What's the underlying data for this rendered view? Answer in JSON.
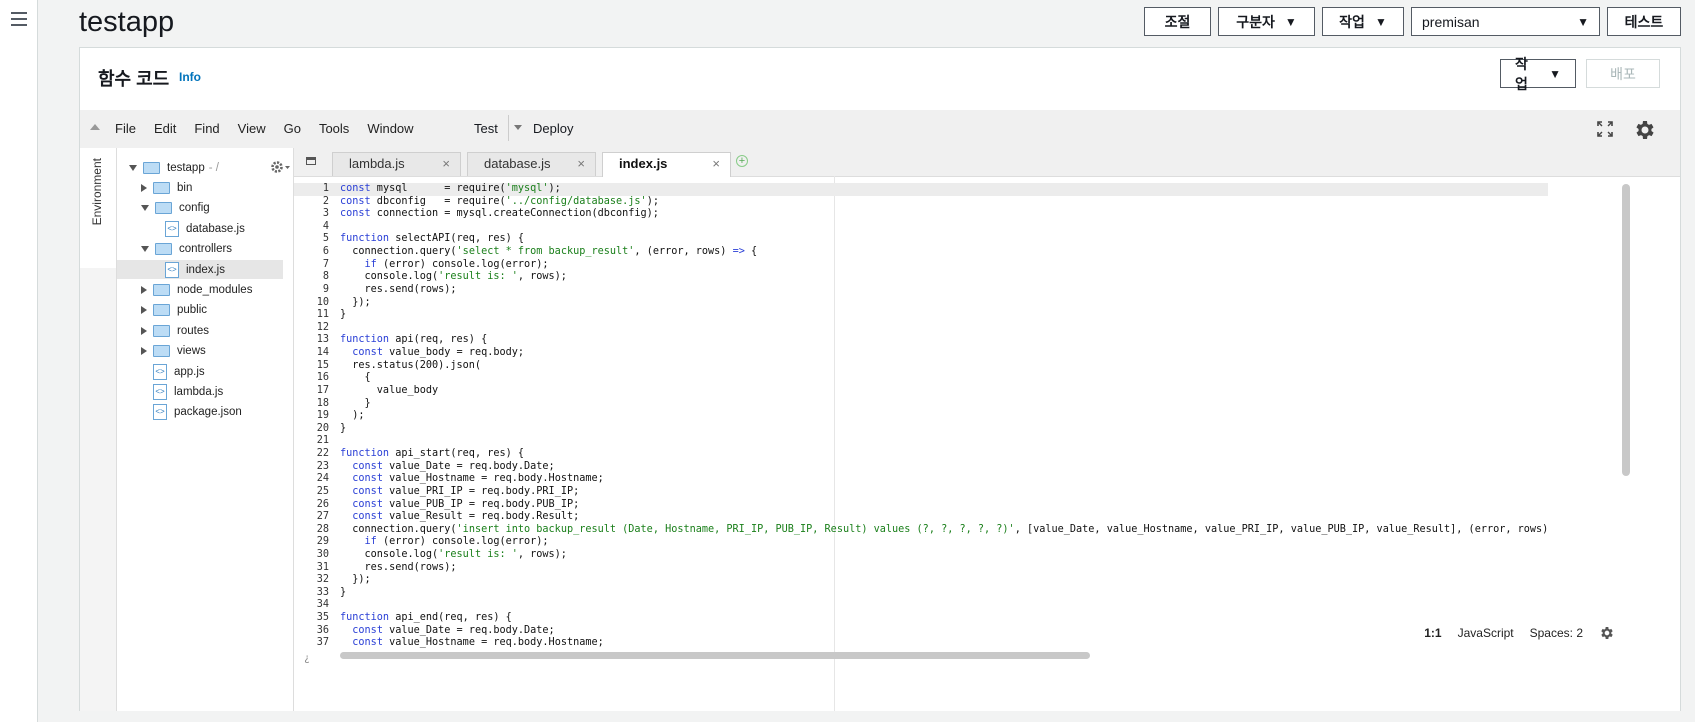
{
  "app": {
    "title": "testapp"
  },
  "top_actions": {
    "adjust": "조절",
    "qualifier": "구분자",
    "actions": "작업",
    "alias_selected": "premisan",
    "test": "테스트"
  },
  "panel": {
    "title": "함수 코드",
    "info": "Info",
    "actions": "작업",
    "deploy": "배포"
  },
  "menubar": {
    "items": [
      "File",
      "Edit",
      "Find",
      "View",
      "Go",
      "Tools",
      "Window"
    ],
    "test": "Test",
    "deploy": "Deploy"
  },
  "side_tab": {
    "environment": "Environment"
  },
  "tree": {
    "root": "testapp",
    "root_suffix": "- /",
    "items": [
      {
        "name": "bin",
        "type": "folder",
        "expanded": false
      },
      {
        "name": "config",
        "type": "folder",
        "expanded": true
      },
      {
        "name": "database.js",
        "type": "file"
      },
      {
        "name": "controllers",
        "type": "folder",
        "expanded": true
      },
      {
        "name": "index.js",
        "type": "file",
        "selected": true
      },
      {
        "name": "node_modules",
        "type": "folder",
        "expanded": false
      },
      {
        "name": "public",
        "type": "folder",
        "expanded": false
      },
      {
        "name": "routes",
        "type": "folder",
        "expanded": false
      },
      {
        "name": "views",
        "type": "folder",
        "expanded": false
      },
      {
        "name": "app.js",
        "type": "file"
      },
      {
        "name": "lambda.js",
        "type": "file"
      },
      {
        "name": "package.json",
        "type": "file"
      }
    ]
  },
  "tabs": [
    {
      "label": "lambda.js",
      "active": false
    },
    {
      "label": "database.js",
      "active": false
    },
    {
      "label": "index.js",
      "active": true
    }
  ],
  "code": [
    "const mysql      = require('mysql');",
    "const dbconfig   = require('../config/database.js');",
    "const connection = mysql.createConnection(dbconfig);",
    "",
    "function selectAPI(req, res) {",
    "  connection.query('select * from backup_result', (error, rows) => {",
    "    if (error) console.log(error);",
    "    console.log('result is: ', rows);",
    "    res.send(rows);",
    "  });",
    "}",
    "",
    "function api(req, res) {",
    "  const value_body = req.body;",
    "  res.status(200).json(",
    "    {",
    "      value_body",
    "    }",
    "  );",
    "}",
    "",
    "function api_start(req, res) {",
    "  const value_Date = req.body.Date;",
    "  const value_Hostname = req.body.Hostname;",
    "  const value_PRI_IP = req.body.PRI_IP;",
    "  const value_PUB_IP = req.body.PUB_IP;",
    "  const value_Result = req.body.Result;",
    "  connection.query('insert into backup_result (Date, Hostname, PRI_IP, PUB_IP, Result) values (?, ?, ?, ?, ?)', [value_Date, value_Hostname, value_PRI_IP, value_PUB_IP, value_Result], (error, rows)",
    "    if (error) console.log(error);",
    "    console.log('result is: ', rows);",
    "    res.send(rows);",
    "  });",
    "}",
    "",
    "function api_end(req, res) {",
    "  const value_Date = req.body.Date;",
    "  const value_Hostname = req.body.Hostname;"
  ],
  "status": {
    "position": "1:1",
    "language": "JavaScript",
    "spaces": "Spaces: 2"
  },
  "colors": {
    "keyword": "#2a3fd6",
    "string": "#1a7f1a",
    "link": "#0073bb"
  }
}
